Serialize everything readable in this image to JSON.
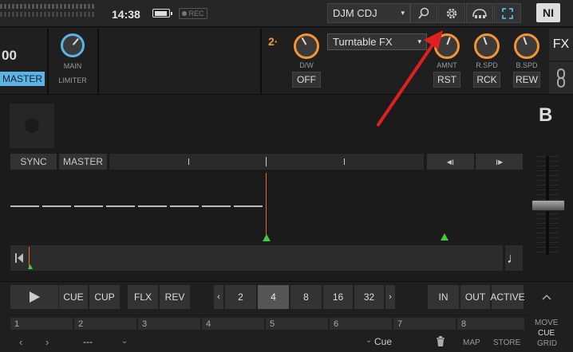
{
  "topbar": {
    "time": "14:38",
    "battery_level": 0.85,
    "rec_label": "REC",
    "device": "DJM CDJ",
    "icons": [
      "search-icon",
      "gear-icon",
      "audio-device-icon",
      "fullscreen-icon"
    ],
    "logo": "NI"
  },
  "deck_left": {
    "bpm_fragment": "00",
    "master_label": "MASTER",
    "main_knob_label": "MAIN",
    "limiter_label": "LIMITER"
  },
  "fx": {
    "unit_number": "2",
    "unit_dot": "·",
    "effect": "Turntable FX",
    "dw_label": "D/W",
    "off_label": "OFF",
    "knobs": [
      {
        "label": "AMNT",
        "button": "RST"
      },
      {
        "label": "R.SPD",
        "button": "RCK"
      },
      {
        "label": "B.SPD",
        "button": "REW"
      }
    ],
    "tab_label": "FX",
    "accent": "#f39632"
  },
  "deck": {
    "letter": "B",
    "sync_label": "SYNC",
    "master_label": "MASTER",
    "nudge_left": "◂ı",
    "nudge_right": "ı▸",
    "note_icon": "♩",
    "playhead_color": "#e8682c",
    "marker_color": "#3fcf3a"
  },
  "transport": {
    "cue_label": "CUE",
    "cup_label": "CUP",
    "flx_label": "FLX",
    "rev_label": "REV",
    "loop_sizes": [
      "2",
      "4",
      "8",
      "16",
      "32"
    ],
    "loop_selected": "4",
    "in_label": "IN",
    "out_label": "OUT",
    "active_label": "ACTIVE"
  },
  "hotcues": {
    "slots": [
      "1",
      "2",
      "3",
      "4",
      "5",
      "6",
      "7",
      "8"
    ],
    "nav_left": "‹",
    "nav_right": "›",
    "name_value": "---",
    "cue_type": "Cue",
    "map_label": "MAP",
    "store_label": "STORE",
    "move_label": "MOVE",
    "cue_label": "CUE",
    "grid_label": "GRID"
  }
}
